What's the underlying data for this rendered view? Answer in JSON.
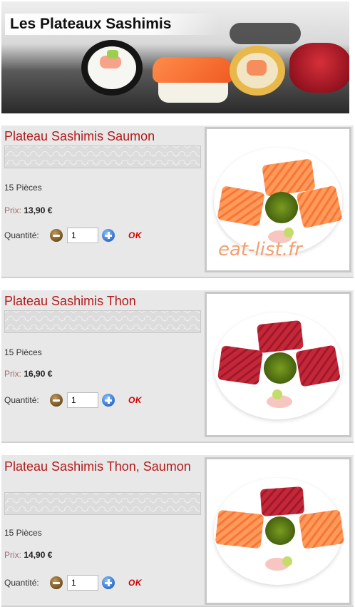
{
  "banner": {
    "title": "Les Plateaux Sashimis"
  },
  "products": [
    {
      "title": "Plateau Sashimis Saumon",
      "pieces": "15 Pièces",
      "price_label": "Prix:",
      "price": "13,90 €",
      "qty_label": "Quantité:",
      "qty": "1",
      "ok_label": "OK",
      "watermark": "eat-list.fr",
      "fish": "salmon"
    },
    {
      "title": "Plateau Sashimis Thon",
      "pieces": "15 Pièces",
      "price_label": "Prix:",
      "price": "16,90 €",
      "qty_label": "Quantité:",
      "qty": "1",
      "ok_label": "OK",
      "fish": "tuna"
    },
    {
      "title": "Plateau Sashimis Thon, Saumon",
      "pieces": "15 Pièces",
      "price_label": "Prix:",
      "price": "14,90 €",
      "qty_label": "Quantité:",
      "qty": "1",
      "ok_label": "OK",
      "fish": "mixed"
    }
  ],
  "colors": {
    "title_red": "#b11b1b",
    "ok_red": "#d40000",
    "card_bg": "#e8e8e8"
  },
  "icons": {
    "minus": "minus-circle-icon",
    "plus": "plus-circle-icon"
  }
}
